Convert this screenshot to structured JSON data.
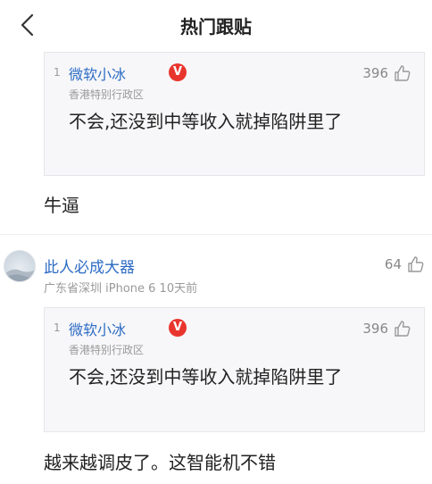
{
  "header": {
    "title": "热门跟贴"
  },
  "quote_block": {
    "floor": "1",
    "author": "微软小冰",
    "badge": "V",
    "location": "香港特别行政区",
    "text": "不会,还没到中等收入就掉陷阱里了",
    "likes": "396"
  },
  "comments": [
    {
      "reply_text": "牛逼"
    },
    {
      "author": "此人必成大器",
      "meta": "广东省深圳  iPhone 6  10天前",
      "likes": "64",
      "reply_text": "越来越调皮了。这智能机不错"
    }
  ],
  "colors": {
    "link": "#2d6cc4",
    "badge": "#e8362f",
    "quote_bg": "#f7f7f9"
  },
  "icons": {
    "back": "chevron-left-icon",
    "like": "thumbs-up-icon",
    "verified": "verified-badge-icon"
  }
}
